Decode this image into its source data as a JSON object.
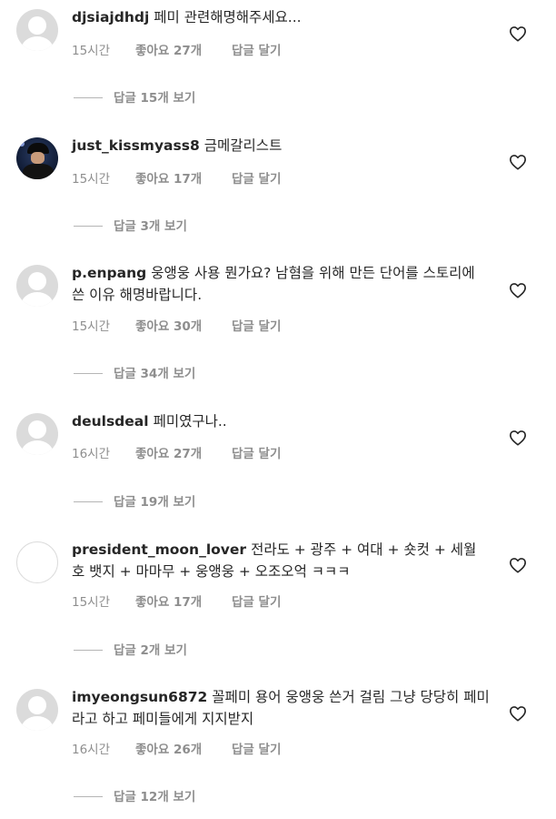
{
  "comments": [
    {
      "username": "djsiajdhdj",
      "text": "페미 관련해명해주세요...",
      "time": "15시간",
      "likes": "좋아요 27개",
      "reply_label": "답글 달기",
      "view_replies": "답글 15개 보기",
      "avatar": "default-avatar-icon"
    },
    {
      "username": "just_kissmyass8",
      "text": "금메갈리스트",
      "time": "15시간",
      "likes": "좋아요 17개",
      "reply_label": "답글 달기",
      "view_replies": "답글 3개 보기",
      "avatar": "profile-photo"
    },
    {
      "username": "p.enpang",
      "text": "웅앵웅 사용 뭔가요? 남혐을 위해 만든 단어를 스토리에 쓴 이유 해명바랍니다.",
      "time": "15시간",
      "likes": "좋아요 30개",
      "reply_label": "답글 달기",
      "view_replies": "답글 34개 보기",
      "avatar": "default-avatar-icon"
    },
    {
      "username": "deulsdeal",
      "text": "페미였구나..",
      "time": "16시간",
      "likes": "좋아요 27개",
      "reply_label": "답글 달기",
      "view_replies": "답글 19개 보기",
      "avatar": "default-avatar-icon"
    },
    {
      "username": "president_moon_lover",
      "text": "전라도 + 광주 + 여대 + 숏컷 + 세월호 뱃지 + 마마무 + 웅앵웅 + 오조오억 ㅋㅋㅋ",
      "time": "15시간",
      "likes": "좋아요 17개",
      "reply_label": "답글 달기",
      "view_replies": "답글 2개 보기",
      "avatar": "blank-avatar"
    },
    {
      "username": "imyeongsun6872",
      "text": "꼴페미 용어 웅앵웅 쓴거 걸림 그냥 당당히 페미라고 하고 페미들에게 지지받지",
      "time": "16시간",
      "likes": "좋아요 26개",
      "reply_label": "답글 달기",
      "view_replies": "답글 12개 보기",
      "avatar": "default-avatar-icon"
    }
  ],
  "like_icon": "heart-outline-icon",
  "colors": {
    "text": "#262626",
    "secondary": "#8e8e8e",
    "avatar_gray": "#dbdbdb"
  }
}
